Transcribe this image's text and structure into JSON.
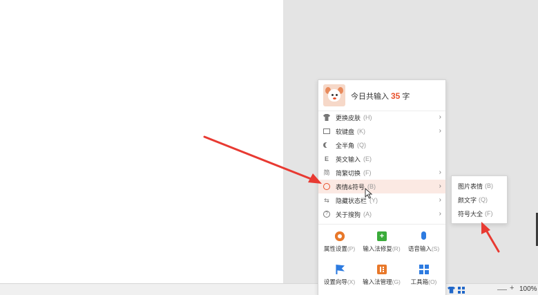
{
  "sogou_menu": {
    "header": {
      "prefix": "今日共输入",
      "count": "35",
      "suffix": "字"
    },
    "items": [
      {
        "label": "更换皮肤",
        "shortcut": "(H)",
        "icon": "shirt-icon",
        "has_submenu": true
      },
      {
        "label": "软键盘",
        "shortcut": "(K)",
        "icon": "keyboard-icon",
        "has_submenu": true
      },
      {
        "label": "全半角",
        "shortcut": "(Q)",
        "icon": "moon-icon",
        "has_submenu": false
      },
      {
        "label": "英文输入",
        "shortcut": "(E)",
        "icon": "english-icon",
        "has_submenu": false
      },
      {
        "label": "简繁切换",
        "shortcut": "(F)",
        "icon": "jianfan-icon",
        "has_submenu": true
      },
      {
        "label": "表情&符号",
        "shortcut": "(B)",
        "icon": "emoji-icon",
        "has_submenu": true
      },
      {
        "label": "隐藏状态栏",
        "shortcut": "(Y)",
        "icon": "hide-statusbar-icon",
        "has_submenu": true
      },
      {
        "label": "关于搜狗",
        "shortcut": "(A)",
        "icon": "about-icon",
        "has_submenu": true
      }
    ],
    "tools": [
      {
        "label": "属性设置",
        "shortcut": "(P)",
        "icon": "gear-icon"
      },
      {
        "label": "输入法修复",
        "shortcut": "(R)",
        "icon": "repair-icon"
      },
      {
        "label": "语音输入",
        "shortcut": "(S)",
        "icon": "microphone-icon"
      },
      {
        "label": "设置向导",
        "shortcut": "(X)",
        "icon": "flag-icon"
      },
      {
        "label": "输入法管理",
        "shortcut": "(G)",
        "icon": "manage-icon"
      },
      {
        "label": "工具箱",
        "shortcut": "(O)",
        "icon": "toolbox-icon"
      }
    ]
  },
  "submenu": {
    "items": [
      {
        "label": "图片表情",
        "shortcut": "(B)"
      },
      {
        "label": "颜文字",
        "shortcut": "(Q)"
      },
      {
        "label": "符号大全",
        "shortcut": "(F)"
      }
    ]
  },
  "status_bar": {
    "zoom_plus": "+",
    "zoom_level": "100%"
  },
  "colors": {
    "accent": "#e8502a",
    "highlight_row": "#fbe9e3",
    "annotation_arrow": "#e83a32",
    "brand_blue": "#2d7be0"
  }
}
